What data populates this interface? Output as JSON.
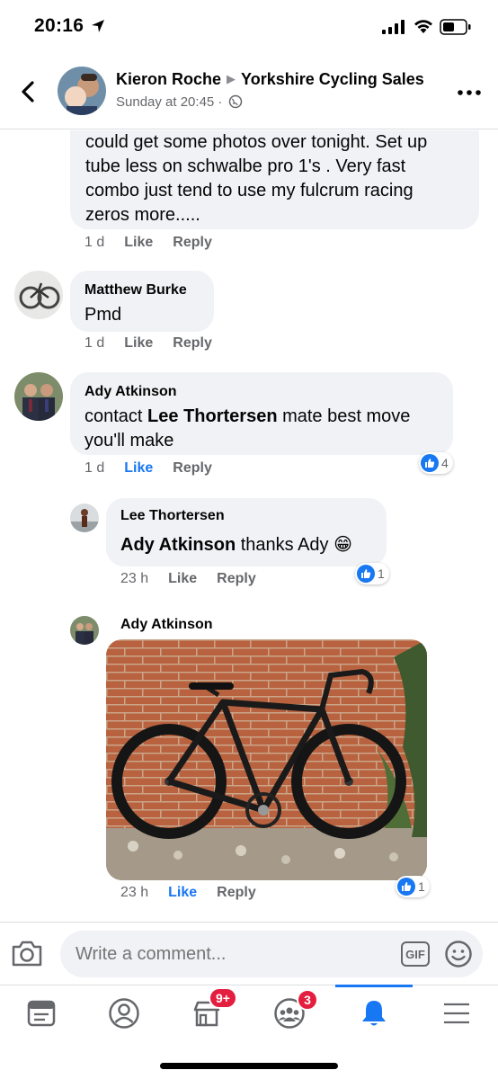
{
  "status": {
    "time": "20:16"
  },
  "header": {
    "poster": "Kieron Roche",
    "group": "Yorkshire Cycling Sales",
    "timestamp": "Sunday at 20:45 ·"
  },
  "comments": [
    {
      "text_lines": [
        "could get some photos over tonight. Set up",
        "tube less on schwalbe pro 1's . Very fast",
        "combo just tend to use my fulcrum racing",
        "zeros more....."
      ],
      "time": "1 d",
      "like": "Like",
      "reply": "Reply"
    },
    {
      "author": "Matthew Burke",
      "text": "Pmd",
      "time": "1 d",
      "like": "Like",
      "reply": "Reply"
    },
    {
      "author": "Ady Atkinson",
      "text_pre": "contact ",
      "mention": "Lee Thortersen",
      "text_post": " mate best move",
      "text_line2": "you'll make",
      "time": "1 d",
      "like": "Like",
      "reply": "Reply",
      "reactions": "4"
    },
    {
      "author": "Lee Thortersen",
      "mention": "Ady Atkinson",
      "text_post": " thanks Ady 😁",
      "time": "23 h",
      "like": "Like",
      "reply": "Reply",
      "reactions": "1"
    },
    {
      "author": "Ady Atkinson",
      "time": "23 h",
      "like": "Like",
      "reply": "Reply",
      "reactions": "1"
    }
  ],
  "composer": {
    "placeholder": "Write a comment...",
    "gif": "GIF"
  },
  "tabs": {
    "marketplace_badge": "9+",
    "groups_badge": "3"
  },
  "colors": {
    "accent": "#1877f2",
    "badge": "#e41e3f",
    "bubble": "#f0f2f5"
  }
}
